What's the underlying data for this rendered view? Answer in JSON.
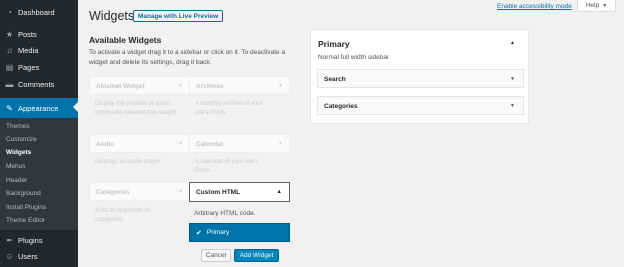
{
  "sidebar": {
    "items": [
      {
        "label": "Dashboard",
        "icon": "dashboard-icon",
        "glyph": "◔"
      },
      {
        "label": "Posts",
        "icon": "pin-icon",
        "glyph": "★"
      },
      {
        "label": "Media",
        "icon": "media-icon",
        "glyph": "♫"
      },
      {
        "label": "Pages",
        "icon": "pages-icon",
        "glyph": "▤"
      },
      {
        "label": "Comments",
        "icon": "comment-icon",
        "glyph": "▬"
      },
      {
        "label": "Appearance",
        "icon": "brush-icon",
        "glyph": "✎"
      },
      {
        "label": "Plugins",
        "icon": "plug-icon",
        "glyph": "✒"
      },
      {
        "label": "Users",
        "icon": "user-icon",
        "glyph": "☺"
      }
    ],
    "submenu": [
      "Themes",
      "Customize",
      "Widgets",
      "Menus",
      "Header",
      "Background",
      "Install Plugins",
      "Theme Editor"
    ],
    "current_submenu": "Widgets"
  },
  "topbar": {
    "accessibility_link": "Enable accessibility mode",
    "help_label": "Help",
    "help_arrow": "▼"
  },
  "header": {
    "title": "Widgets",
    "live_preview_label": "Manage with Live Preview"
  },
  "available": {
    "title": "Available Widgets",
    "description": "To activate a widget drag it to a sidebar or click on it. To deactivate a widget and delete its settings, drag it back.",
    "widgets": [
      {
        "title": "Akismet Widget",
        "desc": "Display the number of spam comments Akismet has caught"
      },
      {
        "title": "Archives",
        "desc": "A monthly archive of your site's Posts."
      },
      {
        "title": "Audio",
        "desc": "Displays an audio player."
      },
      {
        "title": "Calendar",
        "desc": "A calendar of your site's Posts."
      },
      {
        "title": "Categories",
        "desc": "A list or dropdown of categories."
      }
    ],
    "custom_html": {
      "title": "Custom HTML",
      "desc": "Arbitrary HTML code.",
      "chooser_option": "Primary",
      "cancel_label": "Cancel",
      "add_label": "Add Widget"
    }
  },
  "primary_sidebar": {
    "title": "Primary",
    "description": "Normal full width sidebar",
    "widgets": [
      "Search",
      "Categories"
    ]
  },
  "glyphs": {
    "down": "▼",
    "up": "▲",
    "check": "✔"
  },
  "colors": {
    "accent": "#0073aa",
    "admin_bar": "#23282d",
    "submenu_bg": "#32373c",
    "background": "#f1f1f1"
  }
}
